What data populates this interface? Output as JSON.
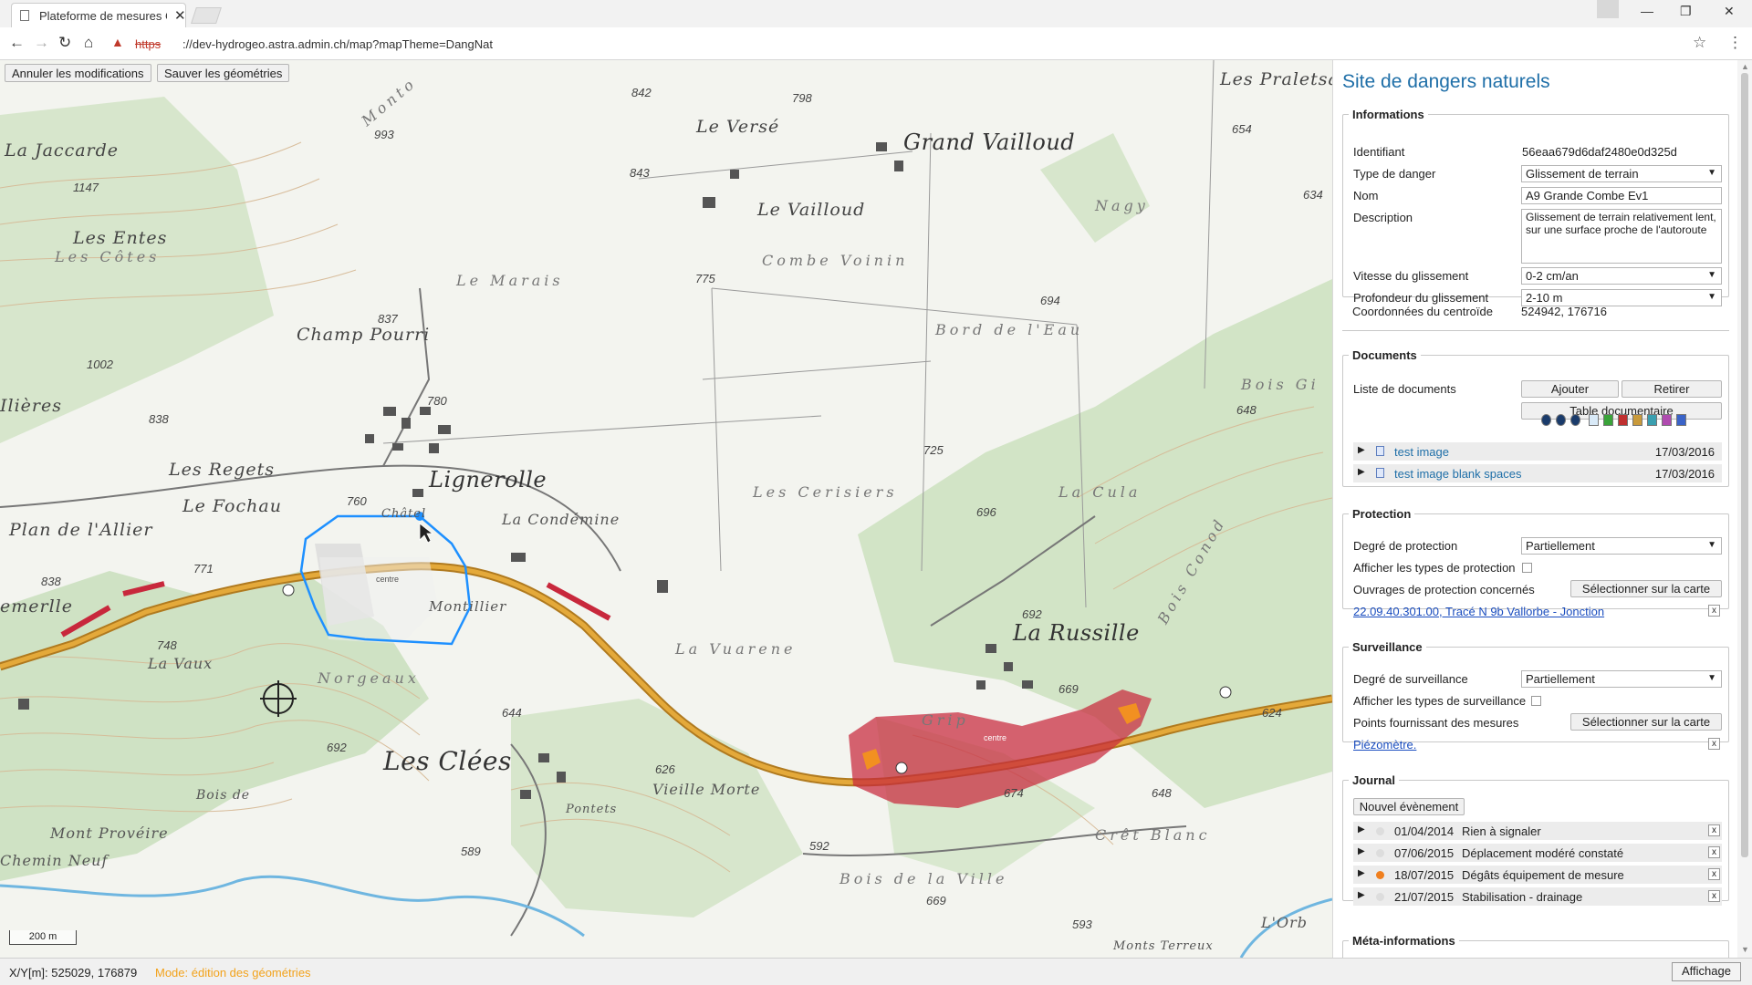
{
  "browser": {
    "tab_title": "Plateforme de mesures C",
    "tab_close": "✕",
    "url_scheme": "https",
    "url_rest": "://dev-hydrogeo.astra.admin.ch/map?mapTheme=DangNat"
  },
  "toolbar": {
    "cancel_label": "Annuler les modifications",
    "save_label": "Sauver les géométries"
  },
  "map": {
    "places": [
      "Monto",
      "La Jaccarde",
      "Les Entes",
      "Les Côtes",
      "Champ Pourri",
      "Le Marais",
      "Le Versé",
      "Grand Vailloud",
      "Le Vailloud",
      "Combe Voinin",
      "Nagy",
      "Bord de l'Eau",
      "Les Praletsa",
      "Lignerolle",
      "La Condémine",
      "Les Cerisiers",
      "La Cula",
      "Bois Gi",
      "Bois Conod",
      "La Russille",
      "Les Regets",
      "Le Fochau",
      "Plan de l'Allier",
      "emerlle",
      "Ilières",
      "Châtel",
      "Montillier",
      "La Vaux",
      "Norgeaux",
      "La Vuarene",
      "Les Clées",
      "Vieille Morte",
      "Pontets",
      "Bois de",
      "Mont Provéire",
      "Chemin Neuf",
      "Bois de la Ville",
      "Crêt Blanc",
      "L'Orb",
      "Monts Terreux",
      "Grip"
    ],
    "altitudes": [
      "798",
      "842",
      "993",
      "1147",
      "843",
      "654",
      "634",
      "775",
      "837",
      "1002",
      "780",
      "838",
      "694",
      "725",
      "648",
      "696",
      "692",
      "760",
      "771",
      "838",
      "748",
      "669",
      "624",
      "692",
      "644",
      "626",
      "648",
      "674",
      "589",
      "592",
      "669",
      "593"
    ],
    "geometry_labels": [
      "centre",
      "centre"
    ],
    "scale_label": "200 m"
  },
  "panel": {
    "title": "Site de dangers naturels",
    "informations": {
      "legend": "Informations",
      "identifiant_label": "Identifiant",
      "identifiant_value": "56eaa679d6daf2480e0d325d",
      "type_label": "Type de danger",
      "type_value": "Glissement de terrain",
      "nom_label": "Nom",
      "nom_value": "A9 Grande Combe Ev1",
      "description_label": "Description",
      "description_value": "Glissement de terrain relativement lent, sur une surface proche de l'autoroute",
      "vitesse_label": "Vitesse du glissement",
      "vitesse_value": "0-2 cm/an",
      "profondeur_label": "Profondeur du glissement",
      "profondeur_value": "2-10 m",
      "coord_label": "Coordonnées du centroïde",
      "coord_value": "524942, 176716"
    },
    "documents": {
      "legend": "Documents",
      "list_label": "Liste de documents",
      "add_label": "Ajouter",
      "remove_label": "Retirer",
      "table_label": "Table documentaire",
      "items": [
        {
          "name": "test image",
          "date": "17/03/2016"
        },
        {
          "name": "test image blank spaces",
          "date": "17/03/2016"
        }
      ]
    },
    "protection": {
      "legend": "Protection",
      "degre_label": "Degré de protection",
      "degre_value": "Partiellement",
      "afficher_label": "Afficher les types de protection",
      "ouvrages_label": "Ouvrages de protection concernés",
      "select_label": "Sélectionner sur la carte",
      "link": "22.09.40.301.00, Tracé N 9b Vallorbe - Jonction"
    },
    "surveillance": {
      "legend": "Surveillance",
      "degre_label": "Degré de surveillance",
      "degre_value": "Partiellement",
      "afficher_label": "Afficher les types de surveillance",
      "points_label": "Points fournissant des mesures",
      "select_label": "Sélectionner sur la carte",
      "link": "Piézomètre."
    },
    "journal": {
      "legend": "Journal",
      "new_label": "Nouvel évènement",
      "entries": [
        {
          "date": "01/04/2014",
          "text": "Rien à signaler",
          "color": "#dddddd"
        },
        {
          "date": "07/06/2015",
          "text": "Déplacement modéré constaté",
          "color": "#dddddd"
        },
        {
          "date": "18/07/2015",
          "text": "Dégâts équipement de mesure",
          "color": "#f07f1e"
        },
        {
          "date": "21/07/2015",
          "text": "Stabilisation - drainage",
          "color": "#dddddd"
        }
      ]
    },
    "meta": {
      "legend": "Méta-informations"
    }
  },
  "status": {
    "coords": "X/Y[m]: 525029, 176879",
    "mode": "Mode: édition des géométries",
    "affichage": "Affichage"
  },
  "icons": {
    "danger_zone_color": "#c8283c",
    "edit_polygon_color": "#1e90ff",
    "highway_color": "#e09a2a"
  }
}
